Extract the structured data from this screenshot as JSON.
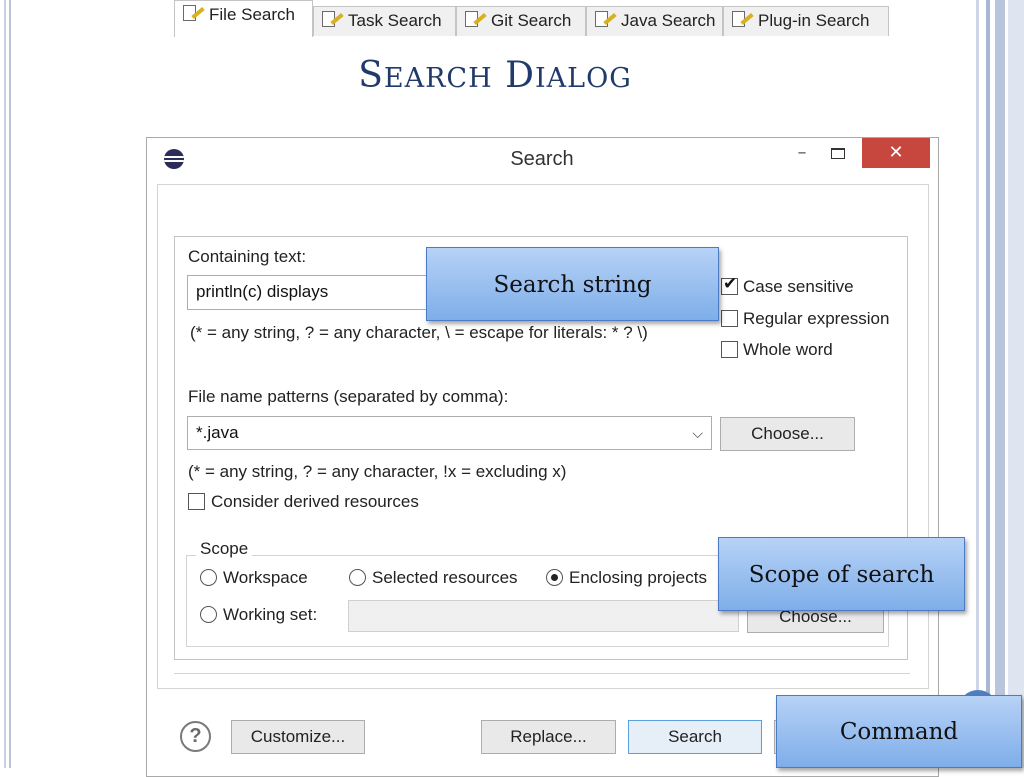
{
  "slide": {
    "title": "Search Dialog"
  },
  "dialog": {
    "title": "Search",
    "window_buttons": {
      "minimize": "–",
      "close": "✕"
    },
    "tabs": [
      {
        "label": "File Search",
        "icon": "file-search-icon",
        "active": true
      },
      {
        "label": "Task Search",
        "icon": "task-search-icon",
        "active": false
      },
      {
        "label": "Git Search",
        "icon": "git-search-icon",
        "active": false
      },
      {
        "label": "Java Search",
        "icon": "java-search-icon",
        "active": false
      },
      {
        "label": "Plug-in Search",
        "icon": "plugin-search-icon",
        "active": false
      }
    ],
    "containing_text": {
      "label": "Containing text:",
      "value": "println(c) displays",
      "hint": "(* = any string, ? = any character, \\ = escape for literals: * ? \\)"
    },
    "options": {
      "case_sensitive": {
        "label": "Case sensitive",
        "checked": true
      },
      "regular_expression": {
        "label": "Regular expression",
        "checked": false
      },
      "whole_word": {
        "label": "Whole word",
        "checked": false
      }
    },
    "file_name_patterns": {
      "label": "File name patterns (separated by comma):",
      "value": "*.java",
      "choose_button": "Choose...",
      "hint": "(* = any string, ? = any character, !x = excluding x)"
    },
    "consider_derived": {
      "label": "Consider derived resources",
      "checked": false
    },
    "scope": {
      "legend": "Scope",
      "workspace": {
        "label": "Workspace",
        "selected": false
      },
      "selected_resources": {
        "label": "Selected resources",
        "selected": false
      },
      "enclosing_projects": {
        "label": "Enclosing projects",
        "selected": true
      },
      "working_set": {
        "label": "Working set:",
        "selected": false,
        "value": ""
      },
      "choose_button": "Choose..."
    },
    "footer": {
      "customize_button": "Customize...",
      "replace_button": "Replace...",
      "search_button": "Search"
    }
  },
  "callouts": {
    "search_string": "Search string",
    "scope_of_search": "Scope of search",
    "command": "Command"
  },
  "colors": {
    "title_text": "#1f3a6b",
    "close_button": "#c7473e",
    "callout_fill": "#8fb7ec",
    "callout_border": "#4c7bc4"
  }
}
